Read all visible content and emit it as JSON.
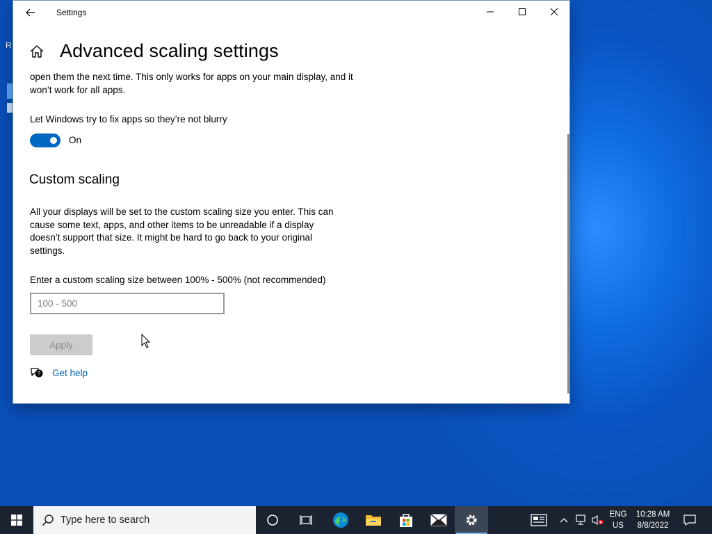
{
  "window": {
    "title": "Settings",
    "page_title": "Advanced scaling settings"
  },
  "section_fix": {
    "description_partial": "open them the next time. This only works for apps on your main display, and it won’t work for all apps.",
    "toggle_label": "Let Windows try to fix apps so they’re not blurry",
    "toggle_state": "On",
    "toggle_on": true
  },
  "custom_scaling": {
    "heading": "Custom scaling",
    "description": "All your displays will be set to the custom scaling size you enter. This can cause some text, apps, and other items to be unreadable if a display doesn’t support that size. It might be hard to go back to your original settings.",
    "input_label": "Enter a custom scaling size between 100% - 500% (not recommended)",
    "input_value": "",
    "input_placeholder": "100 - 500",
    "apply_label": "Apply"
  },
  "help": {
    "link_label": "Get help"
  },
  "taskbar": {
    "search_placeholder": "Type here to search",
    "lang_line1": "ENG",
    "lang_line2": "US",
    "time": "10:28 AM",
    "date": "8/8/2022"
  },
  "desktop": {
    "remnant_text": "R"
  },
  "colors": {
    "accent": "#0067c0",
    "link": "#0063b1",
    "taskbar": "#1b2330"
  }
}
